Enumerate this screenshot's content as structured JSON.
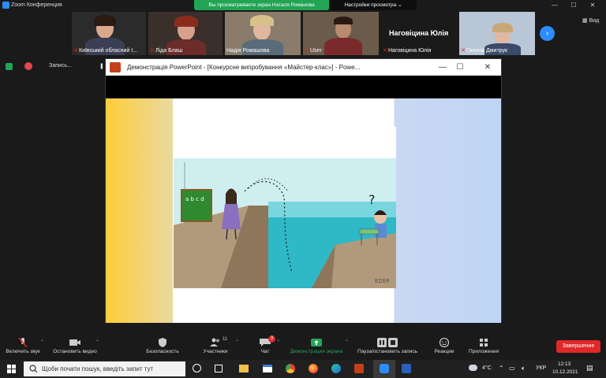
{
  "window": {
    "title": "Zoom Конференция"
  },
  "banners": {
    "sharing": "Вы просматриваете экран Наталя Романова",
    "view_options": "Настройки просмотра ⌄"
  },
  "gallery": {
    "tiles": [
      {
        "name": "Київський обласний І...",
        "muted": true
      },
      {
        "name": "Ліда Блаш",
        "muted": true
      },
      {
        "name": "Надія Ромашова",
        "muted": false
      },
      {
        "name": "User",
        "muted": true
      },
      {
        "name": "Наговіцина Юлія",
        "muted": true,
        "big_name": "Наговіцина Юлія"
      },
      {
        "name": "Галина Дмитрук",
        "muted": true
      }
    ],
    "next_label": "›",
    "view_label": "Вид"
  },
  "status": {
    "recording_label": "Запись..."
  },
  "ppt": {
    "title": "Демонстрація PowerPoint - [Конкурсне випробування «Майстер-клас»] - Powe...",
    "min_label": "—",
    "max_label": "☐",
    "close_label": "✕",
    "cartoon_signature": "EDER",
    "board_text": "a b c d"
  },
  "toolbar": {
    "audio": "Включить звук",
    "video": "Остановить видео",
    "security": "Безопасность",
    "participants": "Участники",
    "participants_count": "11",
    "chat": "Чат",
    "chat_badge": "3",
    "share": "Демонстрация экрана",
    "record": "Пауза/остановить запись",
    "reactions": "Реакции",
    "apps": "Приложения",
    "end": "Завершение"
  },
  "taskbar": {
    "search_placeholder": "Щоби почати пошук, введіть запит тут",
    "weather": "4°C",
    "language": "УКР",
    "time": "12:13",
    "date": "10.12.2021"
  },
  "colors": {
    "accent": "#2d8cff",
    "share_green": "#23a455",
    "danger": "#e02828"
  }
}
